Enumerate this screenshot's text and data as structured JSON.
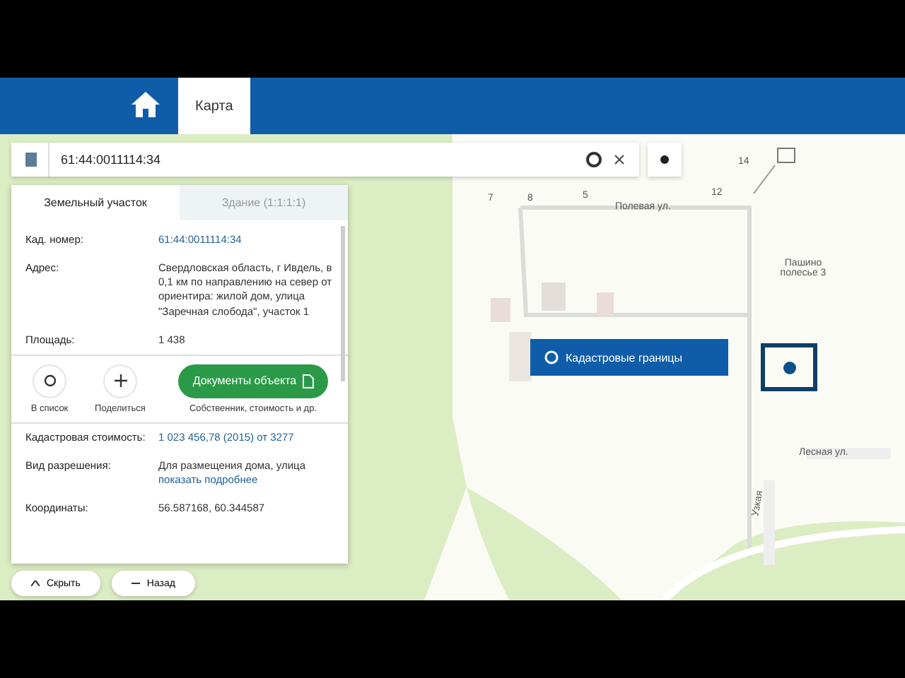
{
  "header": {
    "tabs": [
      {
        "kind": "home",
        "selected": false
      },
      {
        "kind": "text",
        "label": "Карта",
        "selected": true
      }
    ]
  },
  "search": {
    "value": "61:44:0011114:34"
  },
  "panel": {
    "tabs": [
      {
        "label": "Земельный участок",
        "selected": true
      },
      {
        "label": "Здание (1:1:1:1)",
        "selected": false
      }
    ],
    "fields": [
      {
        "label": "Кад. номер:",
        "value": "61:44:0011114:34",
        "link": true
      },
      {
        "label": "Адрес:",
        "value": "Свердловская область, г Ивдель, в 0,1 км по направлению на север от ориентира: жилой дом, улица \"Заречная слобода\", участок 1",
        "link": false
      },
      {
        "label": "Площадь:",
        "value": "1 438",
        "link": false
      }
    ],
    "actions": [
      {
        "kind": "circle",
        "label": "В список"
      },
      {
        "kind": "plus",
        "label": "Поделиться"
      }
    ],
    "doc_button": "Документы объекта",
    "doc_caption": "Собственник, стоимость и др.",
    "fields2": [
      {
        "label": "Кадастровая стоимость:",
        "value": "1 023 456,78 (2015) от 3277",
        "link": true
      },
      {
        "label": "Вид разрешения:",
        "value": "Для размещения дома, улица",
        "link": false,
        "more": "показать подробнее"
      },
      {
        "label": "Координаты:",
        "value": "56.587168, 60.344587",
        "link": false
      }
    ]
  },
  "bottom_buttons": [
    {
      "kind": "up",
      "label": "Скрыть"
    },
    {
      "kind": "dash",
      "label": "Назад"
    }
  ],
  "map": {
    "labels": [
      "7",
      "8",
      "5",
      "12",
      "14"
    ],
    "street": "Полевая ул.",
    "area": "Пашино полесье 3",
    "street2": "Лесная ул.",
    "street3": "Узкая",
    "layer_button": "Кадастровые границы"
  }
}
